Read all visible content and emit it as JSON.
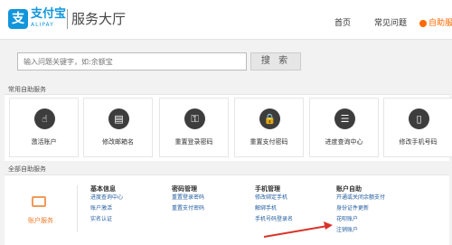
{
  "header": {
    "logo_char": "支",
    "logo_name": "支付宝",
    "logo_en": "ALIPAY",
    "title": "服务大厅",
    "nav": [
      "首页",
      "常见问题"
    ],
    "hot_label": "自助服务",
    "hot_color": "#ff6a00",
    "brand_color": "#1296db"
  },
  "search": {
    "placeholder": "输入问题关键字，如:余额宝",
    "button_label": "搜 索"
  },
  "common": {
    "title": "常用自助服务",
    "cards": [
      {
        "label": "激活账户",
        "icon": "cursor-icon",
        "glyph": "☝"
      },
      {
        "label": "修改邮箱名",
        "icon": "id-card-icon",
        "glyph": "▤"
      },
      {
        "label": "重置登录密码",
        "icon": "key-icon",
        "glyph": "⚿"
      },
      {
        "label": "重置支付密码",
        "icon": "lock-icon",
        "glyph": "🔒"
      },
      {
        "label": "进度查询中心",
        "icon": "document-icon",
        "glyph": "☰"
      },
      {
        "label": "修改手机号码",
        "icon": "phone-icon",
        "glyph": "▯"
      }
    ]
  },
  "all": {
    "title": "全部自助服务",
    "account_service": "账户服务",
    "columns": [
      {
        "head": "基本信息",
        "links": [
          "进度查询中心",
          "账户激活",
          "实名认证"
        ]
      },
      {
        "head": "密码管理",
        "links": [
          "重置登录密码",
          "重置支付密码"
        ]
      },
      {
        "head": "手机管理",
        "links": [
          "修改绑定手机",
          "解绑手机",
          "手机号码登录名"
        ]
      },
      {
        "head": "账户自助",
        "links": [
          "开通或关闭余额支付",
          "身份证件更新",
          "花呗账户",
          "注销账户"
        ]
      }
    ]
  }
}
